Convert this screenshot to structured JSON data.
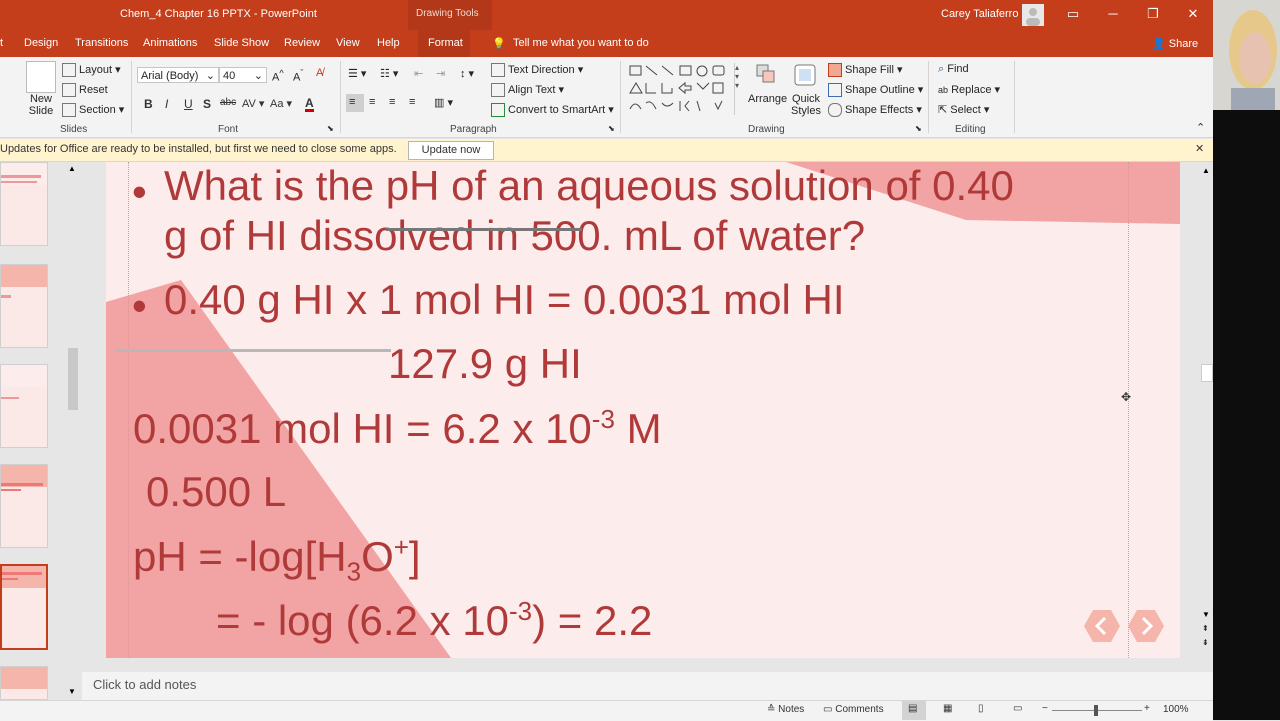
{
  "window": {
    "title": "Chem_4 Chapter 16 PPTX  -  PowerPoint",
    "context_tab": "Drawing Tools",
    "user": "Carey Taliaferro"
  },
  "tabs": [
    "Design",
    "Transitions",
    "Animations",
    "Slide Show",
    "Review",
    "View",
    "Help",
    "Format"
  ],
  "tell_me": "Tell me what you want to do",
  "share": "Share",
  "ribbon": {
    "slides": {
      "new_slide": "New Slide",
      "layout": "Layout",
      "reset": "Reset",
      "section": "Section",
      "label": "Slides"
    },
    "font": {
      "name": "Arial (Body)",
      "size": "40",
      "label": "Font"
    },
    "paragraph": {
      "text_direction": "Text Direction",
      "align_text": "Align Text",
      "convert": "Convert to SmartArt",
      "label": "Paragraph"
    },
    "drawing": {
      "arrange": "Arrange",
      "quick_styles": "Quick Styles",
      "shape_fill": "Shape Fill",
      "shape_outline": "Shape Outline",
      "shape_effects": "Shape Effects",
      "label": "Drawing"
    },
    "editing": {
      "find": "Find",
      "replace": "Replace",
      "select": "Select",
      "label": "Editing"
    }
  },
  "update_bar": {
    "message": "Updates for Office are ready to be installed, but first we need to close some apps.",
    "button": "Update now"
  },
  "slide": {
    "bullet1_line1": "What is the pH of an aqueous solution of 0.40",
    "bullet1_line2": "g of HI dissolved in 500. mL of water?",
    "bullet2_line1": "0.40 g HI x 1 mol HI   = 0.0031 mol HI",
    "bullet2_line2": "127.9 g HI",
    "line3_main": "0.0031 mol HI  = 6.2 x 10",
    "line3_sup": "-3",
    "line3_end": " M",
    "line4": "0.500 L",
    "line5_a": "pH = -log[H",
    "line5_sub": "3",
    "line5_b": "O",
    "line5_sup": "+",
    "line5_c": "]",
    "line6_a": "= - log (6.2 x 10",
    "line6_sup": "-3",
    "line6_b": ") = 2.2"
  },
  "notes_placeholder": "Click to add notes",
  "status": {
    "notes": "Notes",
    "comments": "Comments",
    "zoom": "100%"
  },
  "colors": {
    "accent": "#c43e1c",
    "slide_text": "#b03a3a",
    "slide_bg": "#fdecec"
  }
}
